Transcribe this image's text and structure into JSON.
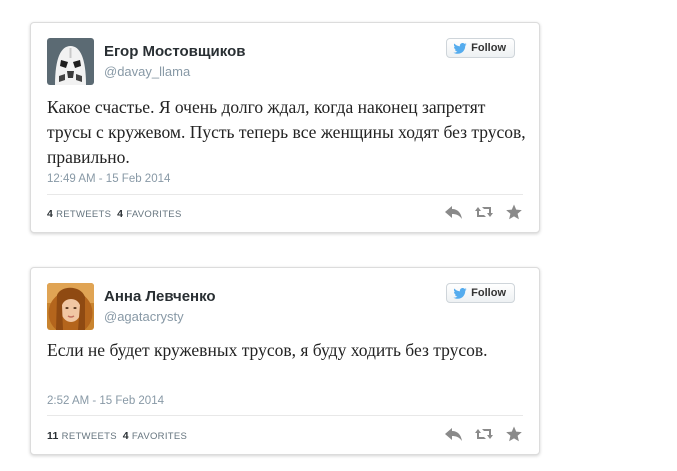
{
  "tweets": [
    {
      "name": "Егор Мостовщиков",
      "handle": "@davay_llama",
      "follow_label": "Follow",
      "text": "Какое счастье. Я очень долго ждал, когда наконец запретят трусы с кружевом. Пусть теперь все женщины ходят без трусов, правильно.",
      "timestamp": "12:49 AM - 15 Feb 2014",
      "retweets_count": "4",
      "retweets_label": "RETWEETS",
      "favorites_count": "4",
      "favorites_label": "FAVORITES",
      "avatar_icon": "stormtrooper-helmet"
    },
    {
      "name": "Анна Левченко",
      "handle": "@agatacrysty",
      "follow_label": "Follow",
      "text": "Если не будет кружевных трусов, я буду ходить без трусов.",
      "timestamp": "2:52 AM - 15 Feb 2014",
      "retweets_count": "11",
      "retweets_label": "RETWEETS",
      "favorites_count": "4",
      "favorites_label": "FAVORITES",
      "avatar_icon": "user-photo"
    }
  ],
  "colors": {
    "twitter_bird": "#55acee",
    "action_icon": "#8a8a8a",
    "secondary_text": "#8899a6"
  }
}
